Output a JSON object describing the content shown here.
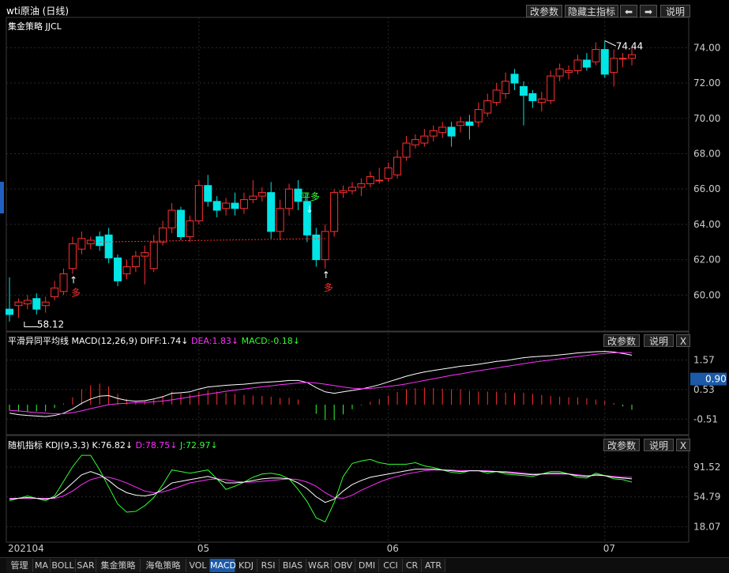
{
  "window": {
    "title": "wti原油 (日线)",
    "buttons": {
      "params": "改参数",
      "hide_main": "隐藏主指标",
      "prev": "⬅",
      "next": "➡",
      "help": "说明"
    }
  },
  "main_panel": {
    "indicator_name": "集金策略 JJCL",
    "y_ticks": [
      "74.00",
      "72.00",
      "70.00",
      "68.00",
      "66.00",
      "64.00",
      "62.00",
      "60.00"
    ],
    "high_label": "74.44",
    "low_label": "58.12",
    "signals": [
      {
        "text": "多",
        "arrow": "↑"
      },
      {
        "text": "平多",
        "arrow": "↓"
      },
      {
        "text": "多",
        "arrow": "↑"
      }
    ]
  },
  "macd_panel": {
    "name": "平滑异同平均线 MACD(12,26,9)",
    "diff": "DIFF:1.74↓",
    "dea": "DEA:1.83↓",
    "macd": "MACD:-0.18↓",
    "y_ticks": [
      "1.57",
      "0.53",
      "-0.51"
    ],
    "current_value": "0.90",
    "buttons": {
      "params": "改参数",
      "help": "说明",
      "close": "X"
    }
  },
  "kdj_panel": {
    "name": "随机指标 KDJ(9,3,3)",
    "k": "K:76.82↓",
    "d": "D:78.75↓",
    "j": "J:72.97↓",
    "y_ticks": [
      "91.52",
      "54.79",
      "18.07"
    ],
    "buttons": {
      "params": "改参数",
      "help": "说明",
      "close": "X"
    }
  },
  "x_axis": {
    "labels": [
      "202104",
      "05",
      "06",
      "07"
    ]
  },
  "bottom_tabs": [
    "管理",
    "MA",
    "BOLL",
    "SAR",
    "集金策略",
    "海龟策略",
    "VOL",
    "MACD",
    "KDJ",
    "RSI",
    "BIAS",
    "W&R",
    "OBV",
    "DMI",
    "CCI",
    "CR",
    "ATR"
  ],
  "active_tab": "MACD",
  "colors": {
    "up": "#ff3030",
    "down": "#00e5e5",
    "diff": "#ffffff",
    "dea": "#ff30ff",
    "macd_neg": "#30ff30",
    "k": "#ffffff",
    "d": "#ff30ff",
    "j": "#30ff30",
    "grid": "#2a2a2a",
    "tab_active": "#1c5aa8"
  },
  "chart_data": [
    {
      "type": "candlestick",
      "title": "wti原油 (日线)",
      "ylim": [
        58,
        75
      ],
      "candles": [
        [
          59.2,
          58.9,
          61.0,
          58.5
        ],
        [
          59.4,
          59.6,
          59.8,
          58.7
        ],
        [
          59.5,
          59.7,
          60.0,
          59.2
        ],
        [
          59.8,
          59.2,
          60.1,
          58.9
        ],
        [
          59.4,
          59.6,
          59.9,
          59.0
        ],
        [
          59.9,
          60.4,
          60.8,
          59.7
        ],
        [
          60.2,
          61.2,
          61.5,
          60.0
        ],
        [
          61.5,
          62.9,
          63.3,
          61.2
        ],
        [
          62.6,
          63.2,
          63.6,
          62.3
        ],
        [
          62.9,
          63.1,
          63.3,
          62.6
        ],
        [
          63.3,
          62.8,
          63.6,
          62.5
        ],
        [
          63.4,
          62.1,
          63.8,
          61.8
        ],
        [
          62.1,
          60.8,
          62.3,
          60.5
        ],
        [
          61.2,
          61.6,
          62.0,
          60.9
        ],
        [
          61.6,
          62.2,
          62.5,
          61.3
        ],
        [
          62.2,
          62.4,
          62.8,
          60.6
        ],
        [
          61.5,
          63.0,
          63.4,
          61.3
        ],
        [
          63.0,
          63.8,
          64.2,
          62.8
        ],
        [
          63.8,
          64.8,
          65.2,
          63.5
        ],
        [
          64.8,
          63.3,
          65.0,
          63.1
        ],
        [
          63.3,
          64.2,
          64.5,
          63.0
        ],
        [
          64.2,
          66.2,
          66.5,
          64.0
        ],
        [
          66.2,
          65.3,
          66.8,
          65.0
        ],
        [
          65.3,
          64.8,
          65.6,
          64.4
        ],
        [
          64.9,
          65.2,
          65.5,
          64.5
        ],
        [
          65.2,
          64.9,
          65.8,
          64.5
        ],
        [
          64.9,
          65.4,
          65.8,
          64.6
        ],
        [
          65.4,
          65.6,
          66.5,
          65.2
        ],
        [
          65.6,
          65.8,
          66.1,
          65.3
        ],
        [
          65.8,
          63.6,
          66.4,
          63.2
        ],
        [
          63.6,
          64.9,
          65.4,
          63.1
        ],
        [
          64.9,
          66.0,
          66.3,
          64.5
        ],
        [
          66.0,
          65.3,
          66.5,
          64.8
        ],
        [
          65.3,
          63.4,
          65.8,
          63.0
        ],
        [
          63.4,
          62.0,
          63.8,
          61.6
        ],
        [
          62.0,
          63.6,
          64.0,
          61.5
        ],
        [
          63.6,
          65.8,
          66.0,
          63.3
        ],
        [
          65.8,
          65.9,
          66.2,
          65.5
        ],
        [
          65.9,
          66.1,
          66.4,
          65.7
        ],
        [
          66.1,
          66.3,
          66.6,
          65.6
        ],
        [
          66.3,
          66.7,
          67.0,
          66.1
        ],
        [
          66.5,
          66.5,
          67.2,
          66.3
        ],
        [
          66.6,
          67.2,
          67.5,
          66.4
        ],
        [
          66.8,
          67.8,
          68.2,
          66.6
        ],
        [
          67.8,
          68.6,
          69.0,
          67.6
        ],
        [
          68.5,
          68.8,
          69.1,
          68.3
        ],
        [
          68.6,
          69.0,
          69.4,
          68.4
        ],
        [
          69.0,
          69.3,
          69.6,
          68.7
        ],
        [
          69.2,
          69.5,
          69.8,
          68.9
        ],
        [
          69.5,
          69.0,
          69.8,
          68.4
        ],
        [
          69.6,
          69.8,
          70.1,
          69.2
        ],
        [
          69.8,
          69.6,
          70.2,
          68.8
        ],
        [
          69.8,
          70.5,
          70.9,
          69.5
        ],
        [
          70.3,
          71.0,
          71.4,
          70.1
        ],
        [
          70.9,
          71.6,
          72.0,
          70.7
        ],
        [
          71.4,
          72.1,
          72.6,
          71.1
        ],
        [
          72.5,
          72.0,
          72.8,
          71.6
        ],
        [
          71.8,
          71.3,
          72.1,
          69.6
        ],
        [
          71.4,
          71.0,
          71.6,
          70.6
        ],
        [
          70.9,
          71.1,
          71.5,
          70.4
        ],
        [
          71.0,
          72.4,
          72.7,
          70.8
        ],
        [
          72.4,
          72.8,
          73.1,
          72.1
        ],
        [
          72.6,
          72.7,
          73.0,
          72.2
        ],
        [
          72.7,
          73.3,
          73.6,
          72.5
        ],
        [
          73.3,
          72.9,
          73.7,
          72.7
        ],
        [
          73.2,
          73.9,
          74.3,
          73.0
        ],
        [
          73.9,
          72.5,
          74.4,
          72.3
        ],
        [
          72.6,
          73.4,
          73.9,
          71.8
        ],
        [
          73.4,
          73.4,
          73.7,
          72.9
        ],
        [
          73.4,
          73.6,
          74.0,
          73.0
        ]
      ]
    },
    {
      "type": "line",
      "title": "平滑异同平均线 MACD(12,26,9)",
      "ylim": [
        -1.0,
        2.0
      ],
      "series": [
        {
          "name": "DIFF",
          "values": [
            -0.3,
            -0.35,
            -0.38,
            -0.4,
            -0.42,
            -0.38,
            -0.3,
            -0.15,
            0.05,
            0.2,
            0.3,
            0.32,
            0.22,
            0.15,
            0.12,
            0.14,
            0.2,
            0.28,
            0.4,
            0.42,
            0.45,
            0.55,
            0.62,
            0.65,
            0.68,
            0.7,
            0.72,
            0.75,
            0.78,
            0.8,
            0.82,
            0.85,
            0.85,
            0.78,
            0.6,
            0.45,
            0.4,
            0.45,
            0.5,
            0.55,
            0.62,
            0.7,
            0.8,
            0.9,
            1.0,
            1.08,
            1.15,
            1.2,
            1.25,
            1.3,
            1.35,
            1.38,
            1.42,
            1.47,
            1.52,
            1.55,
            1.6,
            1.65,
            1.68,
            1.7,
            1.72,
            1.75,
            1.78,
            1.82,
            1.84,
            1.86,
            1.87,
            1.85,
            1.8,
            1.74
          ]
        },
        {
          "name": "DEA",
          "values": [
            -0.2,
            -0.22,
            -0.25,
            -0.28,
            -0.3,
            -0.32,
            -0.32,
            -0.28,
            -0.22,
            -0.14,
            -0.07,
            0.0,
            0.03,
            0.05,
            0.07,
            0.08,
            0.1,
            0.13,
            0.17,
            0.22,
            0.27,
            0.32,
            0.37,
            0.42,
            0.47,
            0.51,
            0.55,
            0.59,
            0.63,
            0.66,
            0.7,
            0.73,
            0.76,
            0.78,
            0.76,
            0.72,
            0.67,
            0.62,
            0.58,
            0.56,
            0.57,
            0.6,
            0.64,
            0.68,
            0.73,
            0.79,
            0.85,
            0.91,
            0.97,
            1.03,
            1.08,
            1.14,
            1.19,
            1.24,
            1.29,
            1.34,
            1.39,
            1.44,
            1.49,
            1.53,
            1.57,
            1.61,
            1.65,
            1.69,
            1.73,
            1.77,
            1.8,
            1.82,
            1.83,
            1.83
          ]
        },
        {
          "name": "MACD",
          "values": [
            -0.2,
            -0.25,
            -0.26,
            -0.24,
            -0.24,
            -0.12,
            0.04,
            0.26,
            0.54,
            0.68,
            0.74,
            0.64,
            0.38,
            0.2,
            0.1,
            0.12,
            0.2,
            0.3,
            0.46,
            0.4,
            0.36,
            0.46,
            0.5,
            0.46,
            0.42,
            0.38,
            0.34,
            0.32,
            0.3,
            0.28,
            0.24,
            0.24,
            0.18,
            0.0,
            -0.32,
            -0.54,
            -0.54,
            -0.34,
            -0.16,
            -0.02,
            0.1,
            0.2,
            0.32,
            0.44,
            0.54,
            0.58,
            0.6,
            0.58,
            0.56,
            0.54,
            0.54,
            0.48,
            0.46,
            0.46,
            0.46,
            0.42,
            0.42,
            0.42,
            0.38,
            0.34,
            0.3,
            0.28,
            0.26,
            0.26,
            0.22,
            0.18,
            0.14,
            0.06,
            -0.06,
            -0.18
          ]
        }
      ]
    },
    {
      "type": "line",
      "title": "随机指标 KDJ(9,3,3)",
      "ylim": [
        0,
        110
      ],
      "series": [
        {
          "name": "K",
          "values": [
            52,
            53,
            54,
            53,
            52,
            54,
            62,
            72,
            82,
            86,
            82,
            75,
            66,
            60,
            57,
            56,
            58,
            64,
            72,
            74,
            76,
            78,
            80,
            77,
            72,
            72,
            73,
            75,
            77,
            78,
            78,
            77,
            72,
            65,
            55,
            48,
            52,
            62,
            70,
            75,
            79,
            81,
            83,
            85,
            87,
            89,
            89,
            89,
            88,
            87,
            86,
            87,
            87,
            86,
            86,
            85,
            84,
            83,
            82,
            83,
            84,
            84,
            83,
            81,
            80,
            82,
            81,
            79,
            78,
            77
          ]
        },
        {
          "name": "D",
          "values": [
            53,
            53,
            53,
            53,
            53,
            53,
            56,
            62,
            70,
            76,
            79,
            79,
            76,
            72,
            67,
            62,
            60,
            61,
            64,
            68,
            72,
            74,
            76,
            77,
            76,
            74,
            73,
            73,
            74,
            75,
            76,
            77,
            76,
            73,
            68,
            60,
            54,
            53,
            57,
            63,
            68,
            73,
            77,
            80,
            83,
            85,
            87,
            88,
            88,
            88,
            87,
            87,
            87,
            87,
            86,
            86,
            85,
            84,
            83,
            83,
            83,
            83,
            83,
            82,
            81,
            81,
            81,
            80,
            79,
            79
          ]
        },
        {
          "name": "J",
          "values": [
            50,
            53,
            56,
            53,
            50,
            56,
            74,
            92,
            106,
            106,
            88,
            67,
            46,
            36,
            37,
            44,
            54,
            70,
            88,
            86,
            84,
            86,
            88,
            77,
            64,
            68,
            73,
            79,
            83,
            84,
            82,
            77,
            64,
            49,
            29,
            24,
            48,
            80,
            96,
            99,
            101,
            97,
            95,
            95,
            95,
            97,
            93,
            91,
            88,
            85,
            84,
            87,
            87,
            84,
            86,
            83,
            82,
            81,
            80,
            83,
            86,
            86,
            83,
            79,
            78,
            84,
            81,
            77,
            76,
            73
          ]
        }
      ]
    }
  ]
}
